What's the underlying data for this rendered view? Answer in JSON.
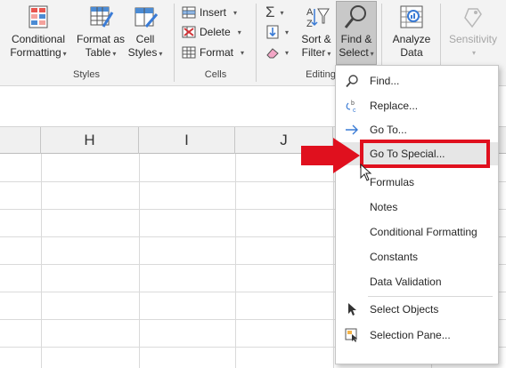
{
  "ribbon": {
    "styles_group": {
      "label": "Styles",
      "conditional_formatting": [
        "Conditional",
        "Formatting"
      ],
      "format_as_table": [
        "Format as",
        "Table"
      ],
      "cell_styles": [
        "Cell",
        "Styles"
      ]
    },
    "cells_group": {
      "label": "Cells",
      "insert": "Insert",
      "delete": "Delete",
      "format": "Format"
    },
    "editing_group": {
      "label": "Editing",
      "sort_filter": [
        "Sort &",
        "Filter"
      ],
      "find_select": [
        "Find &",
        "Select"
      ]
    },
    "analysis": {
      "analyze_data": [
        "Analyze",
        "Data"
      ],
      "sensitivity": "Sensitivity"
    }
  },
  "columns": [
    "H",
    "I",
    "J"
  ],
  "menu": {
    "items": [
      {
        "label": "Find...",
        "icon": "magnifier-icon"
      },
      {
        "label": "Replace...",
        "icon": "replace-icon"
      },
      {
        "label": "Go To...",
        "icon": "arrow-right-icon"
      },
      {
        "label": "Go To Special...",
        "icon": ""
      },
      {
        "label": "Formulas",
        "icon": ""
      },
      {
        "label": "Notes",
        "icon": ""
      },
      {
        "label": "Conditional Formatting",
        "icon": ""
      },
      {
        "label": "Constants",
        "icon": ""
      },
      {
        "label": "Data Validation",
        "icon": ""
      },
      {
        "label": "Select Objects",
        "icon": "pointer-icon"
      },
      {
        "label": "Selection Pane...",
        "icon": "selection-pane-icon"
      }
    ]
  },
  "colors": {
    "highlight_red": "#e0101e",
    "ribbon_bg": "#f3f3f3",
    "menu_hover": "#e6e6e6"
  }
}
